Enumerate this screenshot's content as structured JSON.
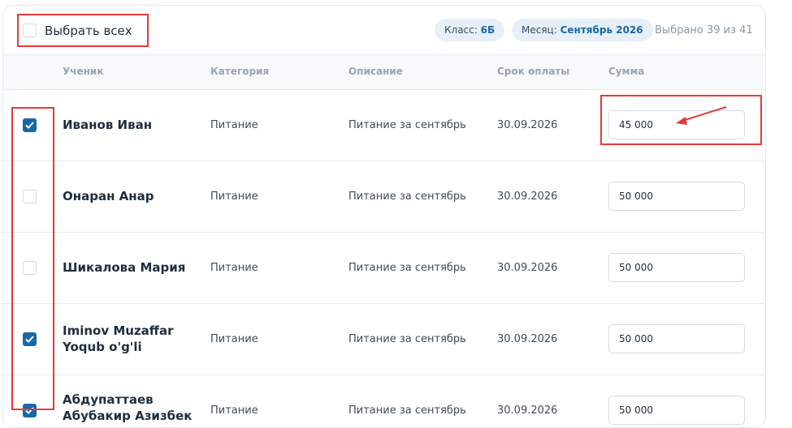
{
  "topbar": {
    "select_all_label": "Выбрать всех",
    "class_label": "Класс:",
    "class_value": "6Б",
    "month_label": "Месяц:",
    "month_value": "Сентябрь 2026",
    "selected_count": "Выбрано 39 из 41"
  },
  "table": {
    "headers": {
      "student": "Ученик",
      "category": "Категория",
      "description": "Описание",
      "due": "Срок оплаты",
      "amount": "Сумма"
    },
    "rows": [
      {
        "name": "Иванов Иван",
        "category": "Питание",
        "description": "Питание за сентябрь",
        "due": "30.09.2026",
        "amount": "45 000",
        "checked": true
      },
      {
        "name": "Онаран Анар",
        "category": "Питание",
        "description": "Питание за сентябрь",
        "due": "30.09.2026",
        "amount": "50 000",
        "checked": false
      },
      {
        "name": "Шикалова Мария",
        "category": "Питание",
        "description": "Питание за сентябрь",
        "due": "30.09.2026",
        "amount": "50 000",
        "checked": false
      },
      {
        "name": "Iminov Muzaffar Yoqub o'g'li",
        "category": "Питание",
        "description": "Питание за сентябрь",
        "due": "30.09.2026",
        "amount": "50 000",
        "checked": true
      },
      {
        "name": "Абдупаттаев Абубакир Азизбек",
        "category": "Питание",
        "description": "Питание за сентябрь",
        "due": "30.09.2026",
        "amount": "50 000",
        "checked": true
      }
    ]
  },
  "colors": {
    "accent": "#1768a8",
    "annotation": "#e8383a"
  }
}
